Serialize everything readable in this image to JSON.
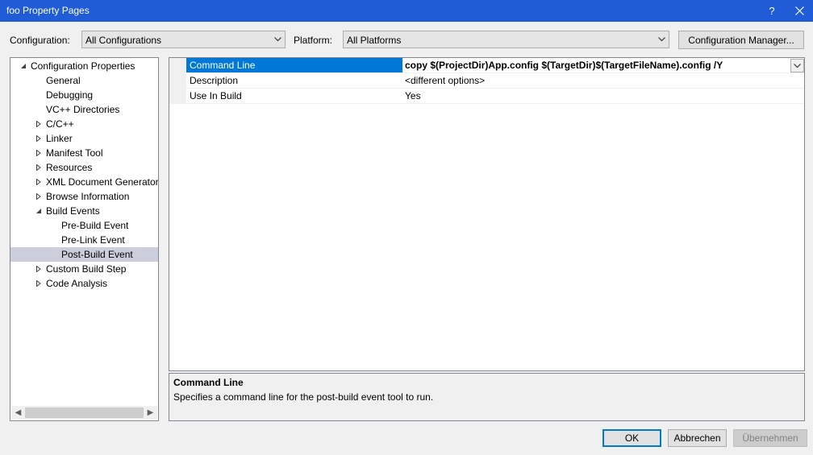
{
  "window": {
    "title": "foo Property Pages",
    "help_glyph": "?",
    "close_glyph": "✕"
  },
  "toolbar": {
    "configuration_label": "Configuration:",
    "configuration_value": "All Configurations",
    "platform_label": "Platform:",
    "platform_value": "All Platforms",
    "config_manager_label": "Configuration Manager..."
  },
  "tree": {
    "items": [
      {
        "label": "Configuration Properties",
        "level": 0,
        "expander": "expanded",
        "selected": false
      },
      {
        "label": "General",
        "level": 1,
        "expander": "none",
        "selected": false
      },
      {
        "label": "Debugging",
        "level": 1,
        "expander": "none",
        "selected": false
      },
      {
        "label": "VC++ Directories",
        "level": 1,
        "expander": "none",
        "selected": false
      },
      {
        "label": "C/C++",
        "level": 1,
        "expander": "collapsed",
        "selected": false
      },
      {
        "label": "Linker",
        "level": 1,
        "expander": "collapsed",
        "selected": false
      },
      {
        "label": "Manifest Tool",
        "level": 1,
        "expander": "collapsed",
        "selected": false
      },
      {
        "label": "Resources",
        "level": 1,
        "expander": "collapsed",
        "selected": false
      },
      {
        "label": "XML Document Generator",
        "level": 1,
        "expander": "collapsed",
        "selected": false
      },
      {
        "label": "Browse Information",
        "level": 1,
        "expander": "collapsed",
        "selected": false
      },
      {
        "label": "Build Events",
        "level": 1,
        "expander": "expanded",
        "selected": false
      },
      {
        "label": "Pre-Build Event",
        "level": 2,
        "expander": "none",
        "selected": false
      },
      {
        "label": "Pre-Link Event",
        "level": 2,
        "expander": "none",
        "selected": false
      },
      {
        "label": "Post-Build Event",
        "level": 2,
        "expander": "none",
        "selected": true
      },
      {
        "label": "Custom Build Step",
        "level": 1,
        "expander": "collapsed",
        "selected": false
      },
      {
        "label": "Code Analysis",
        "level": 1,
        "expander": "collapsed",
        "selected": false
      }
    ]
  },
  "properties": [
    {
      "name": "Command Line",
      "value": "copy $(ProjectDir)App.config $(TargetDir)$(TargetFileName).config /Y",
      "selected": true,
      "bold": true,
      "dropdown": true
    },
    {
      "name": "Description",
      "value": "<different options>",
      "selected": false,
      "bold": false,
      "dropdown": false
    },
    {
      "name": "Use In Build",
      "value": "Yes",
      "selected": false,
      "bold": false,
      "dropdown": false
    }
  ],
  "description": {
    "title": "Command Line",
    "text": "Specifies a command line for the post-build event tool to run."
  },
  "buttons": {
    "ok": "OK",
    "cancel": "Abbrechen",
    "apply": "Übernehmen"
  },
  "colors": {
    "titlebar": "#1f5cd6",
    "selection": "#0078d7",
    "tree_selection": "#cccedb"
  }
}
